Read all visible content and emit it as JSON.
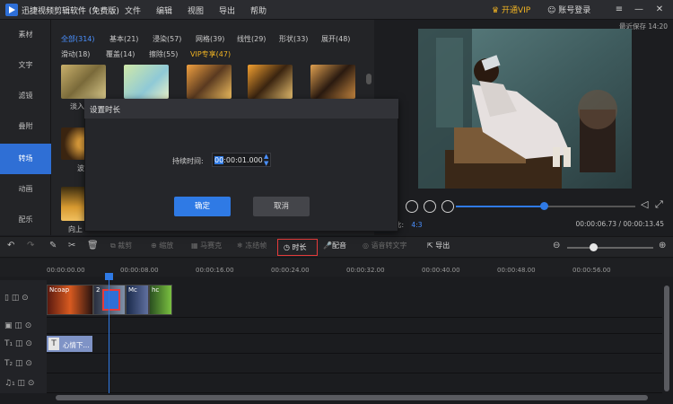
{
  "app": {
    "title": "迅捷视频剪辑软件 (免费版)",
    "menus": [
      "文件",
      "编辑",
      "视图",
      "导出",
      "帮助"
    ],
    "vip_label": "开通VIP",
    "login_label": "账号登录"
  },
  "left_nav": {
    "items": [
      "素材",
      "文字",
      "滤镜",
      "叠附",
      "转场",
      "动画",
      "配乐"
    ],
    "active_index": 4
  },
  "resource": {
    "filters_row1": [
      "全部(314)",
      "基本(21)",
      "浸染(57)",
      "网格(39)",
      "线性(29)",
      "形状(33)",
      "展开(48)"
    ],
    "filters_row2": [
      "滑动(18)",
      "覆盖(14)",
      "擦除(55)",
      "VIP专享(47)"
    ],
    "thumb_labels": [
      "淡入",
      "波",
      "向上"
    ]
  },
  "preview": {
    "saved": "最近保存 14:20",
    "ratio_label": "比:",
    "ratio_value": "4:3",
    "time_current": "00:00:06.73",
    "time_total": "00:00:13.45",
    "progress": 0.49
  },
  "toolbar": {
    "crop": "裁剪",
    "zoom": "缩放",
    "mosaic": "马赛克",
    "freeze": "冻结帧",
    "duration": "时长",
    "dub": "配音",
    "speech_to_text": "语音转文字",
    "export": "导出",
    "zoom_level": 0.3
  },
  "ruler": [
    "00:00:00.00",
    "00:00:08.00",
    "00:00:16.00",
    "00:00:24.00",
    "00:00:32.00",
    "00:00:40.00",
    "00:00:48.00",
    "00:00:56.00"
  ],
  "timeline": {
    "clip_labels": [
      "Ncoap",
      "2",
      "hc",
      "Mc"
    ],
    "text_clip": "心情下..."
  },
  "dialog": {
    "title": "设置时长",
    "duration_label": "持续时间:",
    "duration_value_hh": "00",
    "duration_value_rest": ":00:01.000",
    "confirm": "确定",
    "cancel": "取消"
  },
  "colors": {
    "accent": "#2f7ae5",
    "vip": "#f0b323",
    "highlight": "#e53b3b"
  }
}
